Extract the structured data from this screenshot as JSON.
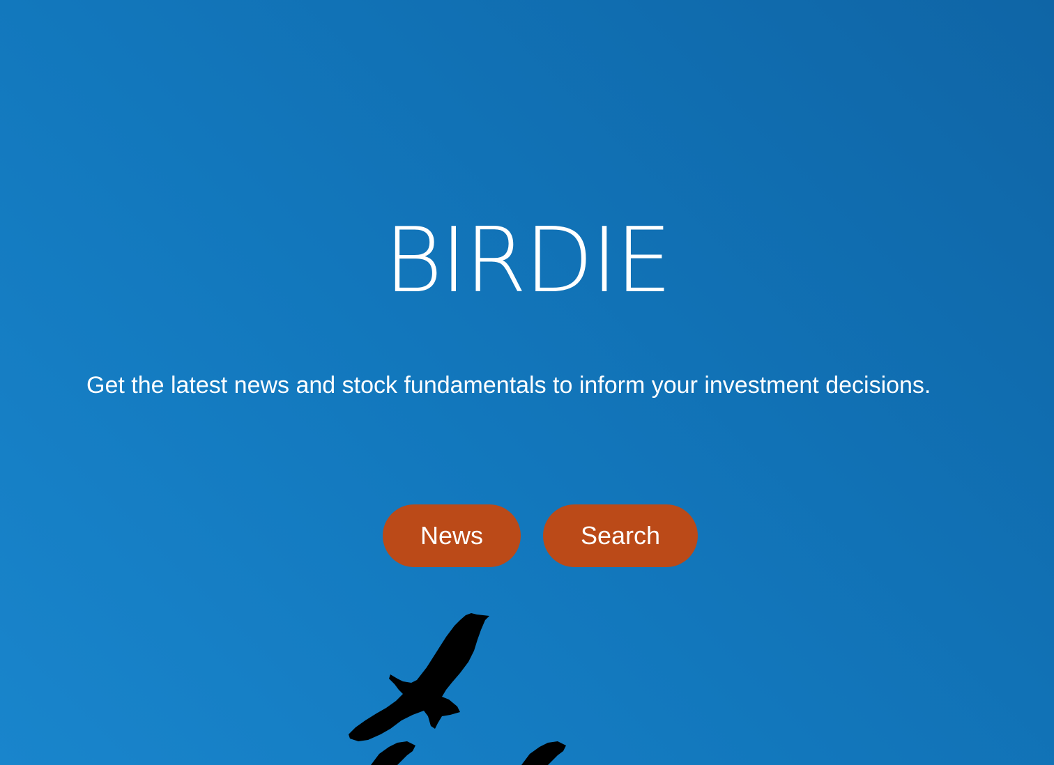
{
  "hero": {
    "title": "BIRDIE",
    "tagline": "Get the latest news and stock fundamentals to inform your investment decisions."
  },
  "actions": {
    "news_label": "News",
    "search_label": "Search"
  },
  "decoration": {
    "icon": "birds-silhouette-icon"
  },
  "colors": {
    "background_start": "#1985cc",
    "background_end": "#0f65a6",
    "button": "#bb4a18",
    "text": "#ffffff",
    "birds": "#000000"
  }
}
